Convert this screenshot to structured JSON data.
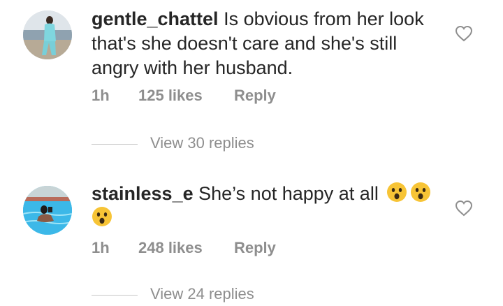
{
  "comments": [
    {
      "username": "gentle_chattel",
      "text": "Is obvious from her look that's she doesn't care and she's still angry with her husband.",
      "time": "1h",
      "likes": "125 likes",
      "reply_label": "Reply",
      "view_replies": "View 30 replies",
      "emojis": []
    },
    {
      "username": "stainless_e",
      "text": "She’s not happy at all",
      "time": "1h",
      "likes": "248 likes",
      "reply_label": "Reply",
      "view_replies": "View 24 replies",
      "emojis": [
        "astonished-face-emoji",
        "astonished-face-emoji",
        "astonished-face-emoji"
      ]
    }
  ],
  "icons": {
    "like": "heart-outline-icon"
  },
  "colors": {
    "text": "#262626",
    "secondary": "#8e8e8e",
    "divider": "#c7c7c7",
    "emoji_face": "#f7c436"
  }
}
